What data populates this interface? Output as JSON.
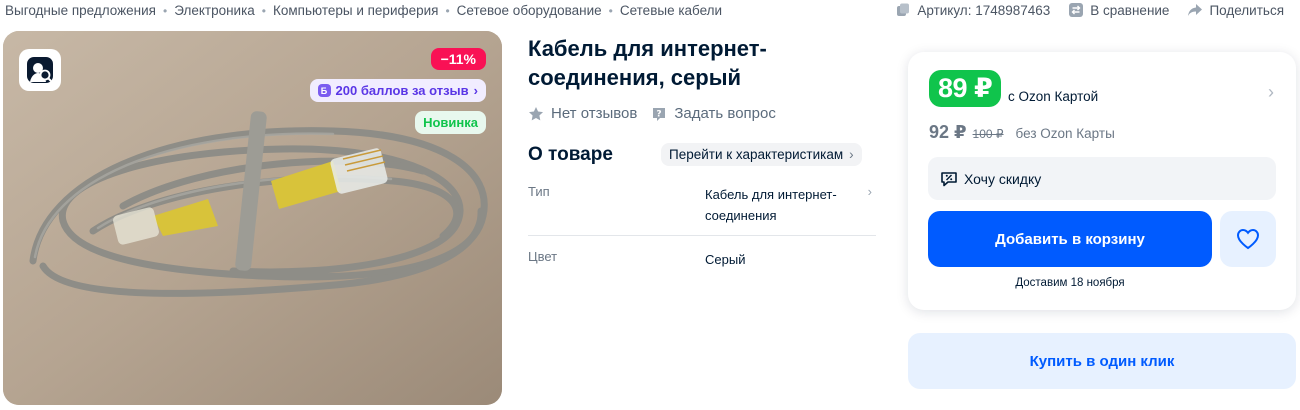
{
  "breadcrumbs": [
    "Выгодные предложения",
    "Электроника",
    "Компьютеры и периферия",
    "Сетевое оборудование",
    "Сетевые кабели"
  ],
  "top_actions": {
    "article": "Артикул: 1748987463",
    "compare": "В сравнение",
    "share": "Поделиться"
  },
  "gallery": {
    "discount": "−11%",
    "points": "200 баллов за отзыв",
    "new_badge": "Новинка"
  },
  "product": {
    "title": "Кабель для интернет-соединения, серый",
    "reviews": "Нет отзывов",
    "ask": "Задать вопрос",
    "about_heading": "О товаре",
    "chars_link": "Перейти к характеристикам",
    "props": [
      {
        "key": "Тип",
        "value": "Кабель для интернет-соединения"
      },
      {
        "key": "Цвет",
        "value": "Серый"
      }
    ]
  },
  "buybox": {
    "price_card": "89 ₽",
    "price_card_label": "с Ozon Картой",
    "price": "92 ₽",
    "price_old": "100 ₽",
    "price_label": "без Ozon Карты",
    "want_discount": "Хочу скидку",
    "add_to_cart": "Добавить в корзину",
    "delivery": "Доставим 18 ноября",
    "one_click": "Купить в один клик"
  },
  "colors": {
    "accent": "#005bff",
    "green": "#10c44c",
    "discount": "#f91155"
  }
}
